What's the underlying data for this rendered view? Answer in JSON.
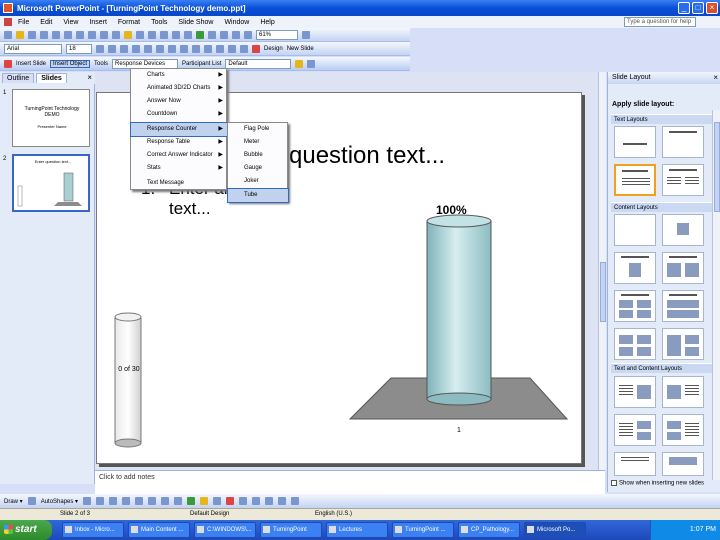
{
  "window": {
    "title": "Microsoft PowerPoint - [TurningPoint Technology demo.ppt]",
    "min": "_",
    "max": "□",
    "close": "×"
  },
  "menu": [
    "File",
    "Edit",
    "View",
    "Insert",
    "Format",
    "Tools",
    "Slide Show",
    "Window",
    "Help"
  ],
  "help_placeholder": "Type a question for help",
  "toolbar": {
    "font": "Arial",
    "size": "18",
    "zoom": "61%",
    "design": "Design",
    "new_slide": "New Slide",
    "insert_slide": "Insert Slide",
    "insert_object": "Insert Object",
    "tools": "Tools",
    "response_devices": "Response Devices",
    "participant_list": "Participant List",
    "default": "Default"
  },
  "panel_tabs": {
    "outline": "Outline",
    "slides": "Slides",
    "close": "×"
  },
  "thumbnails": [
    {
      "num": "1",
      "title": "TurningPoint Technology DEMO",
      "sub": "Presenter Name"
    },
    {
      "num": "2",
      "title": "Enter question text..."
    }
  ],
  "slide": {
    "question": "question text...",
    "answer_num": "1.",
    "answer_text": "Enter answer text...",
    "percent": "100%",
    "category": "1",
    "tube_label": "0 of 30"
  },
  "notes_placeholder": "Click to add notes",
  "dropdown": {
    "items": [
      {
        "label": "Charts",
        "arrow": "▶"
      },
      {
        "label": "Animated 3D/2D Charts",
        "arrow": "▶"
      },
      {
        "label": "Answer Now",
        "arrow": "▶"
      },
      {
        "label": "Countdown",
        "arrow": "▶"
      },
      {
        "label": "Response Counter",
        "arrow": "▶"
      },
      {
        "label": "Response Table",
        "arrow": "▶"
      },
      {
        "label": "Correct Answer Indicator",
        "arrow": "▶"
      },
      {
        "label": "Stats",
        "arrow": "▶"
      },
      {
        "label": "Text Message",
        "arrow": ""
      }
    ],
    "submenu": [
      "Flag Pole",
      "Meter",
      "Bubble",
      "Gauge",
      "Joker",
      "Tube"
    ]
  },
  "taskpane": {
    "title": "Slide Layout",
    "close": "×",
    "heading": "Apply slide layout:",
    "sections": [
      "Text Layouts",
      "Content Layouts",
      "Text and Content Layouts"
    ],
    "footer": "Show when inserting new slides"
  },
  "draw": {
    "draw": "Draw ▾",
    "autoshapes": "AutoShapes ▾"
  },
  "status": {
    "slide": "Slide 2 of 3",
    "design": "Default Design",
    "language": "English (U.S.)"
  },
  "taskbar": {
    "start": "start",
    "buttons": [
      "Inbox - Micro...",
      "Main Content ...",
      "C:\\WINDOWS\\...",
      "TurningPoint",
      "Lectures",
      "TurningPoint ...",
      "CP_Pathology...",
      "Microsoft Po..."
    ],
    "clock": "1:07 PM"
  },
  "colors": {
    "bar": "#a9cfd3",
    "platform": "#8c8c8c",
    "titlebar": "#0a50d8",
    "start": "#3c9a3c"
  }
}
